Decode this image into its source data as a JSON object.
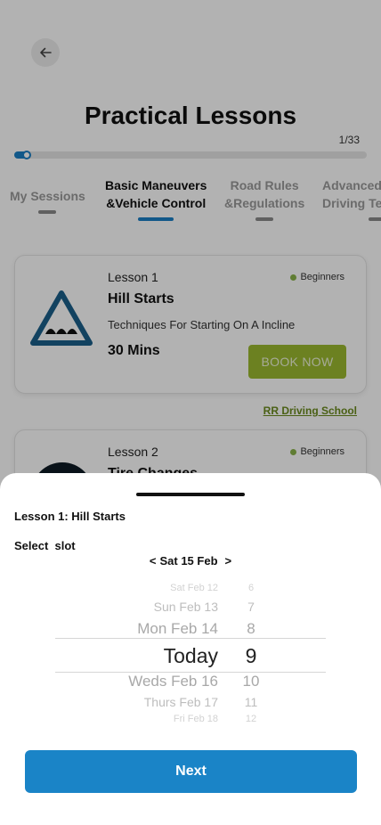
{
  "header": {
    "title": "Practical Lessons",
    "progress_text": "1/33",
    "progress_fraction": 0.04
  },
  "tabs": [
    {
      "label": "My Sessions",
      "active": false
    },
    {
      "label": "Basic Maneuvers\n&Vehicle Control",
      "active": true
    },
    {
      "label": "Road Rules\n&Regulations",
      "active": false
    },
    {
      "label": "Advanced\nDriving Te",
      "active": false
    }
  ],
  "lessons": [
    {
      "number": "Lesson 1",
      "level": "Beginners",
      "title": "Hill Starts",
      "description": "Techniques For Starting On A Incline",
      "duration": "30 Mins",
      "button": "BOOK NOW",
      "school": "RR Driving School"
    },
    {
      "number": "Lesson 2",
      "level": "Beginners",
      "title": "Tire Changes"
    }
  ],
  "sheet": {
    "title": "Lesson 1: Hill Starts",
    "slot_label": "Select  slot",
    "date_prev": "<",
    "date_current": "Sat 15 Feb",
    "date_next": ">",
    "picker": [
      {
        "day": "Sat Feb 12",
        "num": "6"
      },
      {
        "day": "Sun Feb 13",
        "num": "7"
      },
      {
        "day": "Mon Feb 14",
        "num": "8"
      },
      {
        "day": "Today",
        "num": "9"
      },
      {
        "day": "Weds Feb 16",
        "num": "10"
      },
      {
        "day": "Thurs Feb 17",
        "num": "11"
      },
      {
        "day": "Fri Feb 18",
        "num": "12"
      }
    ],
    "next_label": "Next"
  },
  "colors": {
    "accent": "#1a84c7",
    "book_button": "#9bb930",
    "level_dot": "#8ab34a"
  }
}
